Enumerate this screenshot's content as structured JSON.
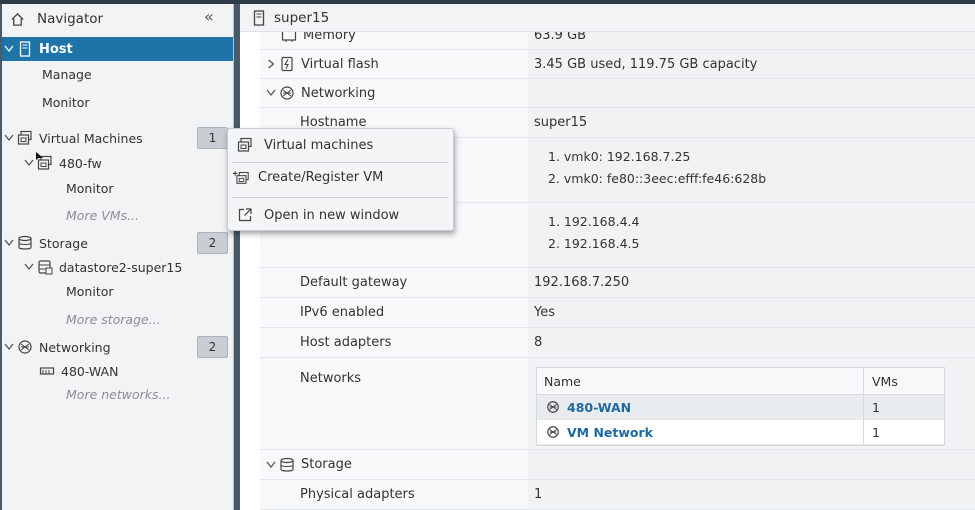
{
  "navigator": {
    "title": "Navigator",
    "host": {
      "label": "Host",
      "children": [
        "Manage",
        "Monitor"
      ]
    },
    "virtual_machines": {
      "label": "Virtual Machines",
      "count": "1",
      "vm": "480-fw",
      "vm_child": "Monitor",
      "more": "More VMs..."
    },
    "storage": {
      "label": "Storage",
      "count": "2",
      "datastore": "datastore2-super15",
      "ds_child": "Monitor",
      "more": "More storage..."
    },
    "networking": {
      "label": "Networking",
      "count": "2",
      "network": "480-WAN",
      "more": "More networks..."
    }
  },
  "main": {
    "title": "super15",
    "memory": {
      "label": "Memory",
      "value": "63.9 GB"
    },
    "virtual_flash": {
      "label": "Virtual flash",
      "value": "3.45 GB used, 119.75 GB capacity"
    },
    "networking": {
      "label": "Networking"
    },
    "hostname": {
      "label": "Hostname",
      "value": "super15"
    },
    "ip_addresses": [
      "1. vmk0: 192.168.7.25",
      "2. vmk0: fe80::3eec:efff:fe46:628b"
    ],
    "dns_servers": [
      "1. 192.168.4.4",
      "2. 192.168.4.5"
    ],
    "default_gateway": {
      "label": "Default gateway",
      "value": "192.168.7.250"
    },
    "ipv6_enabled": {
      "label": "IPv6 enabled",
      "value": "Yes"
    },
    "host_adapters": {
      "label": "Host adapters",
      "value": "8"
    },
    "networks": {
      "label": "Networks",
      "columns": [
        "Name",
        "VMs"
      ],
      "rows": [
        {
          "name": "480-WAN",
          "vms": "1"
        },
        {
          "name": "VM Network",
          "vms": "1"
        }
      ]
    },
    "storage": {
      "label": "Storage"
    },
    "physical_adapters": {
      "label": "Physical adapters",
      "value": "1"
    }
  },
  "context_menu": {
    "items": [
      "Virtual machines",
      "Create/Register VM",
      "Open in new window"
    ]
  },
  "colors": {
    "accent": "#1e74a8",
    "link": "#1e6aa0"
  }
}
